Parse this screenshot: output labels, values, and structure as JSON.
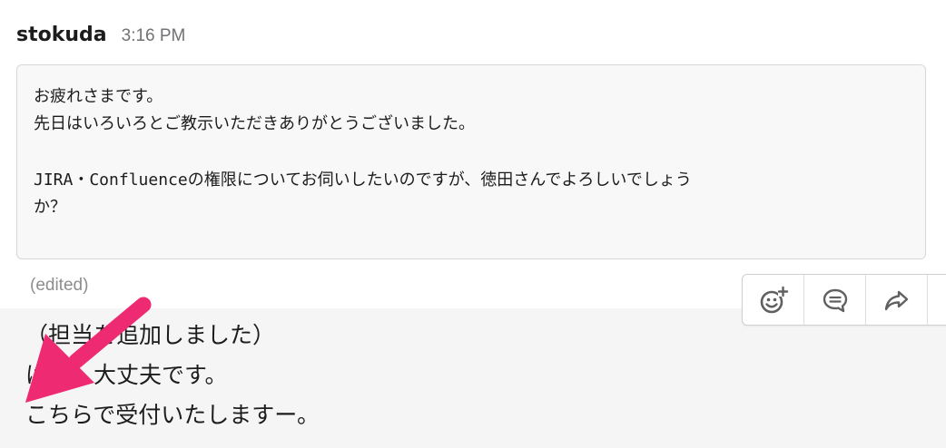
{
  "message": {
    "author": "stokuda",
    "time": "3:16 PM",
    "code_lines": [
      "お疲れさまです。",
      "先日はいろいろとご教示いただきありがとうございました。",
      "",
      "JIRA・Confluenceの権限についてお伺いしたいのですが、徳田さんでよろしいでしょう",
      "か？"
    ],
    "edited_label": "(edited)"
  },
  "reply": {
    "lines": [
      "（担当を追加しました）",
      "はい、大丈夫です。",
      "こちらで受付いたしますー。"
    ]
  },
  "actions": {
    "items": [
      {
        "icon": "add-reaction-icon"
      },
      {
        "icon": "reply-thread-icon"
      },
      {
        "icon": "share-forward-icon"
      }
    ]
  },
  "annotation": {
    "arrow_color": "#ee2a73"
  }
}
